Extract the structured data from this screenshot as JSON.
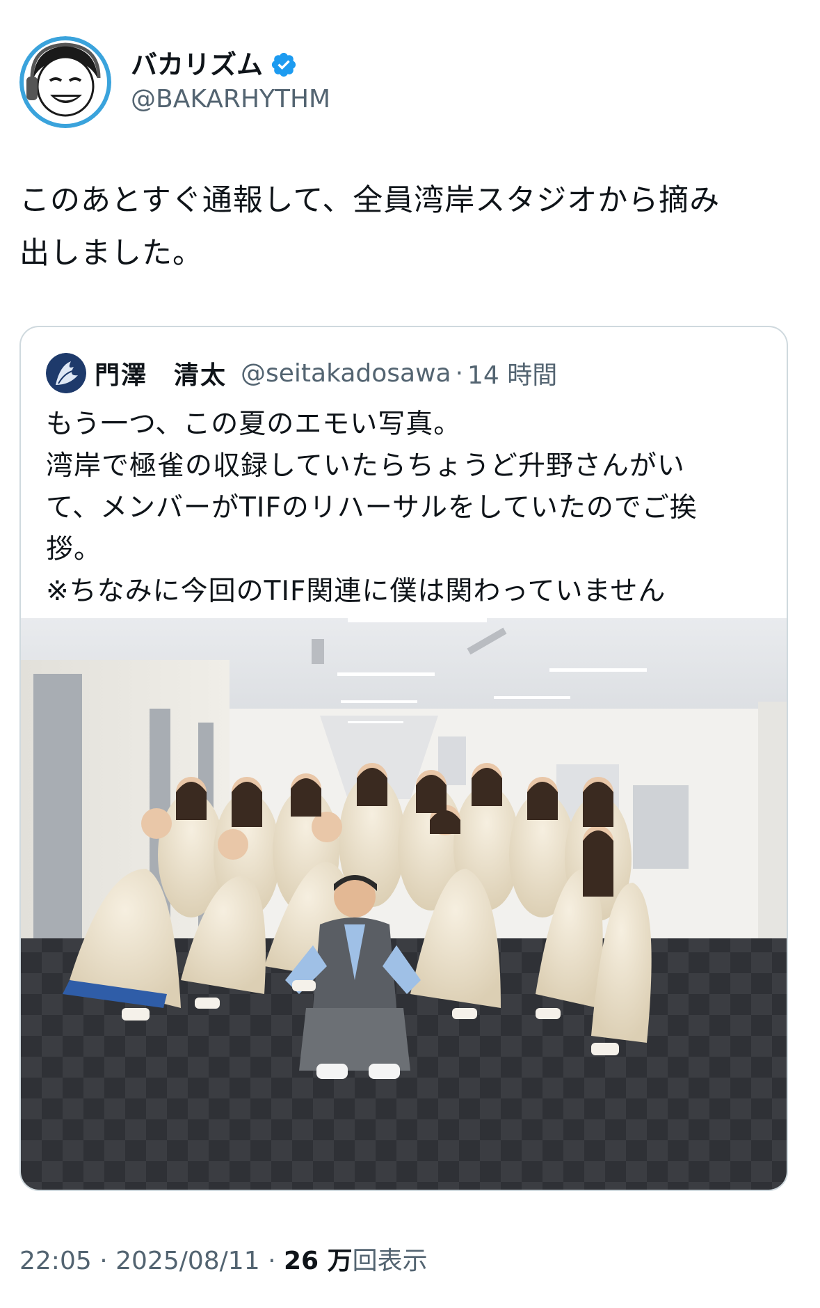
{
  "author": {
    "display_name": "バカリズム",
    "handle": "@BAKARHYTHM",
    "verified": true,
    "verified_color": "#1d9bf0"
  },
  "tweet": {
    "text": "このあとすぐ通報して、全員湾岸スタジオから摘み\n出しました。"
  },
  "quote": {
    "display_name": "門澤　清太",
    "handle": "@seitakadosawa",
    "separator": "·",
    "time": "14 時間",
    "text": "もう一つ、この夏のエモい写真。\n湾岸で極雀の収録していたらちょうど升野さんがい\nて、メンバーがTIFのリハーサルをしていたのでご挨\n拶。\n※ちなみに今回のTIF関連に僕は関わっていません"
  },
  "meta": {
    "time": "22:05",
    "sep1": "·",
    "date": "2025/08/11",
    "sep2": "·",
    "views_count": "26 万",
    "views_label": "回表示"
  },
  "colors": {
    "text_primary": "#0f1419",
    "text_secondary": "#536471",
    "border": "#cfd9de",
    "accent": "#1d9bf0"
  }
}
